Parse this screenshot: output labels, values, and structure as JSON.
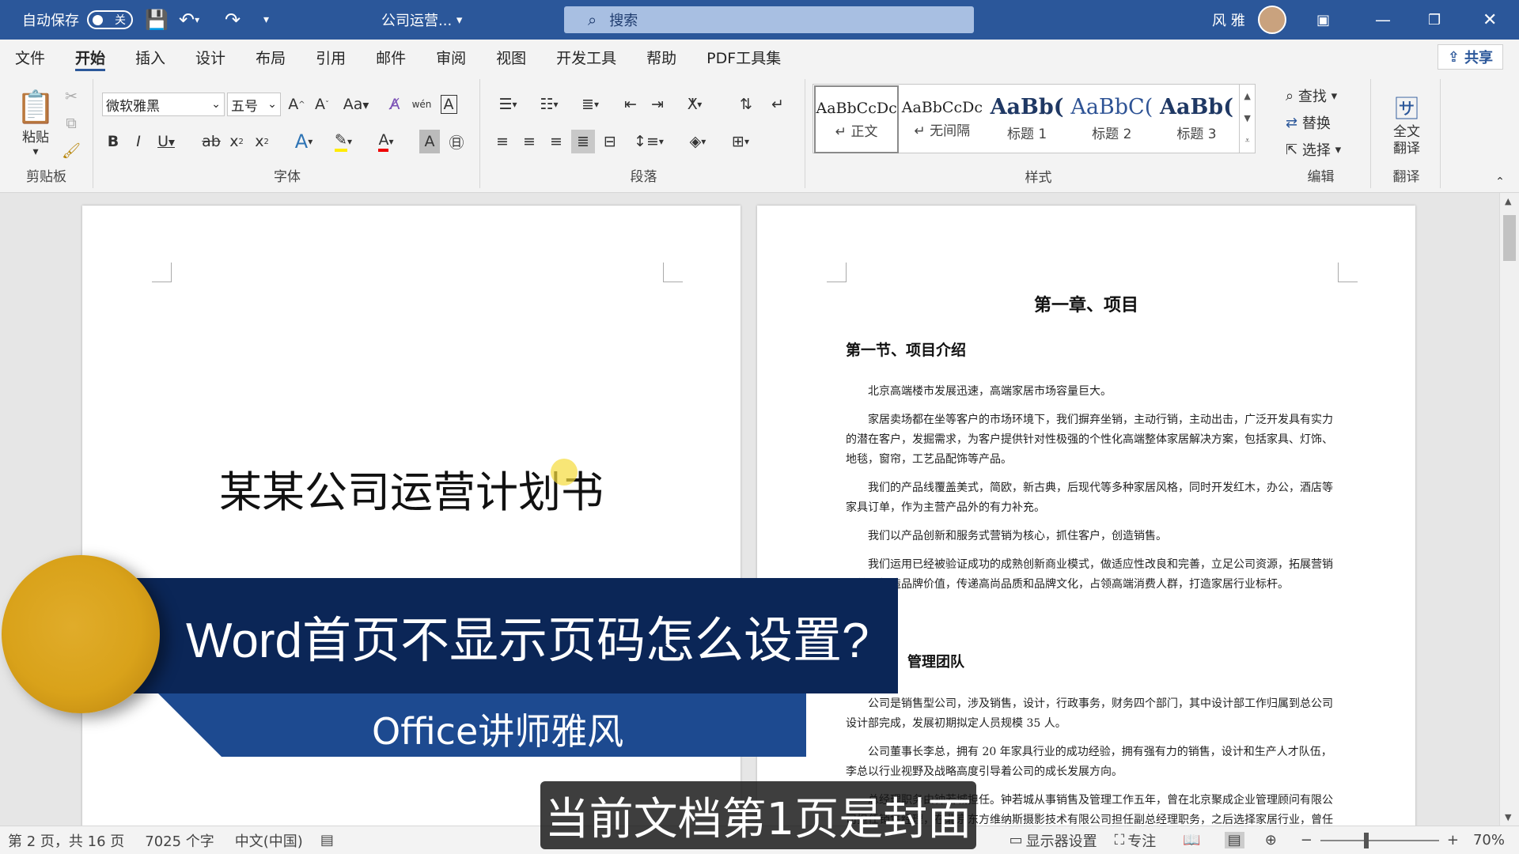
{
  "titlebar": {
    "autosave_label": "自动保存",
    "autosave_state": "关",
    "doc_title": "公司运营...",
    "search_placeholder": "搜索",
    "user_name": "风 雅"
  },
  "tabs": [
    "文件",
    "开始",
    "插入",
    "设计",
    "布局",
    "引用",
    "邮件",
    "审阅",
    "视图",
    "开发工具",
    "帮助",
    "PDF工具集"
  ],
  "share_label": "共享",
  "ribbon": {
    "clipboard": {
      "paste_label": "粘贴",
      "group_label": "剪贴板"
    },
    "font": {
      "font_name": "微软雅黑",
      "font_size": "五号",
      "group_label": "字体"
    },
    "paragraph": {
      "group_label": "段落"
    },
    "styles": {
      "group_label": "样式",
      "items": [
        {
          "sample": "AaBbCcDc",
          "name": "↵ 正文"
        },
        {
          "sample": "AaBbCcDc",
          "name": "↵ 无间隔"
        },
        {
          "sample": "AaBb(",
          "name": "标题 1"
        },
        {
          "sample": "AaBbC(",
          "name": "标题 2"
        },
        {
          "sample": "AaBb(",
          "name": "标题 3"
        }
      ]
    },
    "editing": {
      "find": "查找",
      "replace": "替换",
      "select": "选择",
      "group_label": "编辑"
    },
    "translate": {
      "label": "全文翻译",
      "group_label": "翻译"
    }
  },
  "page1": {
    "title": "某某公司运营计划书"
  },
  "page2": {
    "chapter": "第一章、项目",
    "section": "第一节、项目介绍",
    "paragraphs": [
      "北京高端楼市发展迅速，高端家居市场容量巨大。",
      "家居卖场都在坐等客户的市场环境下，我们摒弃坐销，主动行销，主动出击，广泛开发具有实力的潜在客户，发掘需求，为客户提供针对性极强的个性化高端整体家居解决方案，包括家具、灯饰、地毯，窗帘，工艺品配饰等产品。",
      "我们的产品线覆盖美式，简欧，新古典，后现代等多种家居风格，同时开发红木，办公，酒店等家具订单，作为主营产品外的有力补充。",
      "我们以产品创新和服务式营销为核心，抓住客户，创造销售。",
      "我们运用已经被验证成功的成熟创新商业模式，做适应性改良和完善，立足公司资源，拓展营销系统，打造品牌价值，传递高尚品质和品牌文化，占领高端消费人群，打造家居行业标杆。"
    ],
    "section2": "管理团队",
    "paragraphs2": [
      "公司是销售型公司，涉及销售，设计，行政事务，财务四个部门，其中设计部工作归属到总公司设计部完成，发展初期拟定人员规模 35 人。",
      "公司董事长李总，拥有 20 年家具行业的成功经验，拥有强有力的销售，设计和生产人才队伍，李总以行业视野及战略高度引导着公司的成长发展方向。",
      "总经理职务由钟若城担任。钟若城从事销售及管理工作五年，曾在北京聚成企业管理顾问有限公司担任销售经理，在北京东方维纳斯摄影技术有限公司担任副总经理职务，之后选择家居行业，曾任北京某某家居公司从事销售管理工作。"
    ]
  },
  "overlay": {
    "banner_title": "Word首页不显示页码怎么设置?",
    "banner_sub": "Office讲师雅风",
    "caption": "当前文档第1页是封面"
  },
  "status": {
    "page": "第 2 页，共 16 页",
    "words": "7025 个字",
    "lang": "中文(中国)",
    "display_settings": "显示器设置",
    "focus": "专注",
    "zoom": "70%"
  }
}
